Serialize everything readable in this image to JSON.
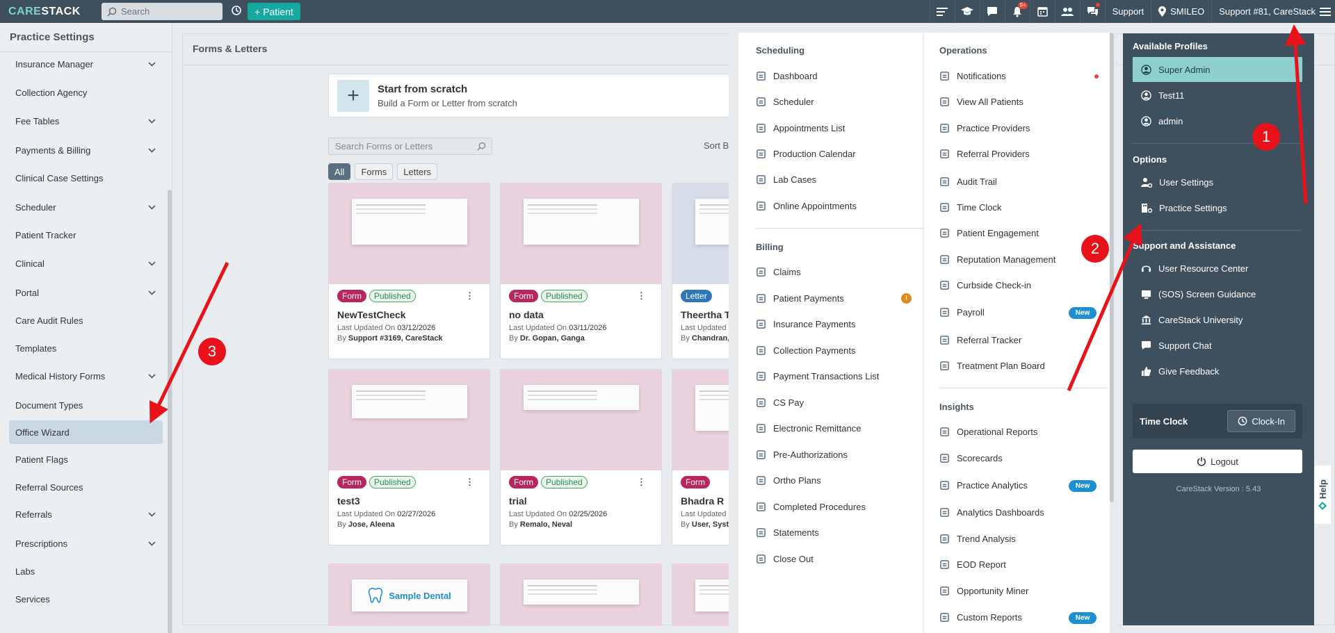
{
  "topbar": {
    "logo_care": "CARE",
    "logo_stack": "STACK",
    "search_placeholder": "Search",
    "patient_label": "Patient",
    "notifications_badge": "9+",
    "support_label": "Support",
    "location_label": "SMILEO",
    "user_label": "Support #81, CareStack"
  },
  "sidebar": {
    "title": "Practice Settings",
    "items": [
      {
        "label": "Insurance Manager",
        "expandable": true
      },
      {
        "label": "Collection Agency",
        "expandable": false
      },
      {
        "label": "Fee Tables",
        "expandable": true
      },
      {
        "label": "Payments & Billing",
        "expandable": true
      },
      {
        "label": "Clinical Case Settings",
        "expandable": false
      },
      {
        "label": "Scheduler",
        "expandable": true
      },
      {
        "label": "Patient Tracker",
        "expandable": false
      },
      {
        "label": "Clinical",
        "expandable": true
      },
      {
        "label": "Portal",
        "expandable": true
      },
      {
        "label": "Care Audit Rules",
        "expandable": false
      },
      {
        "label": "Templates",
        "expandable": false
      },
      {
        "label": "Medical History Forms",
        "expandable": true
      },
      {
        "label": "Document Types",
        "expandable": false
      },
      {
        "label": "Office Wizard",
        "expandable": false,
        "active": true
      },
      {
        "label": "Patient Flags",
        "expandable": false
      },
      {
        "label": "Referral Sources",
        "expandable": false
      },
      {
        "label": "Referrals",
        "expandable": true
      },
      {
        "label": "Prescriptions",
        "expandable": true
      },
      {
        "label": "Labs",
        "expandable": false
      },
      {
        "label": "Services",
        "expandable": false
      }
    ]
  },
  "main": {
    "title": "Forms & Letters",
    "scratch_title": "Start from scratch",
    "scratch_subtitle": "Build a Form or Letter from scratch",
    "search_placeholder": "Search Forms or Letters",
    "sort_label": "Sort By",
    "filters": [
      "All",
      "Forms",
      "Letters"
    ],
    "cards": [
      {
        "type": "Form",
        "status": "Published",
        "name": "NewTestCheck",
        "updated_label": "Last Updated On",
        "updated": "03/12/2026",
        "by_label": "By",
        "by": "Support #3169, CareStack"
      },
      {
        "type": "Form",
        "status": "Published",
        "name": "no data",
        "updated_label": "Last Updated On",
        "updated": "03/11/2026",
        "by_label": "By",
        "by": "Dr. Gopan, Ganga"
      },
      {
        "type": "Letter",
        "status": "",
        "name": "Theertha T",
        "updated_label": "Last Updated O",
        "updated": "",
        "by_label": "By",
        "by": "Chandran, A"
      },
      {
        "type": "Form",
        "status": "Published",
        "name": "test3",
        "updated_label": "Last Updated On",
        "updated": "02/27/2026",
        "by_label": "By",
        "by": "Jose, Aleena"
      },
      {
        "type": "Form",
        "status": "Published",
        "name": "trial",
        "updated_label": "Last Updated On",
        "updated": "02/25/2026",
        "by_label": "By",
        "by": "Remalo, Neval"
      },
      {
        "type": "Form",
        "status": "",
        "name": "Bhadra R",
        "updated_label": "Last Updated O",
        "updated": "",
        "by_label": "By",
        "by": "User, Syste"
      }
    ],
    "sample_dental": "Sample Dental"
  },
  "mega": {
    "scheduling_head": "Scheduling",
    "scheduling": [
      "Dashboard",
      "Scheduler",
      "Appointments List",
      "Production Calendar",
      "Lab Cases",
      "Online Appointments"
    ],
    "billing_head": "Billing",
    "billing": [
      "Claims",
      "Patient Payments",
      "Insurance Payments",
      "Collection Payments",
      "Payment Transactions List",
      "CS Pay",
      "Electronic Remittance",
      "Pre-Authorizations",
      "Ortho Plans",
      "Completed Procedures",
      "Statements",
      "Close Out"
    ],
    "operations_head": "Operations",
    "operations": [
      "Notifications",
      "View All Patients",
      "Practice Providers",
      "Referral Providers",
      "Audit Trail",
      "Time Clock",
      "Patient Engagement",
      "Reputation Management",
      "Curbside Check-in",
      "Payroll",
      "Referral Tracker",
      "Treatment Plan Board"
    ],
    "insights_head": "Insights",
    "insights": [
      "Operational Reports",
      "Scorecards",
      "Practice Analytics",
      "Analytics Dashboards",
      "Trend Analysis",
      "EOD Report",
      "Opportunity Miner",
      "Custom Reports"
    ],
    "new_label": "New",
    "warn_symbol": "!"
  },
  "profile": {
    "available_head": "Available Profiles",
    "profiles": [
      "Super Admin",
      "Test11",
      "admin"
    ],
    "options_head": "Options",
    "options": [
      "User Settings",
      "Practice Settings"
    ],
    "support_head": "Support and Assistance",
    "support": [
      "User Resource Center",
      "(SOS) Screen Guidance",
      "CareStack University",
      "Support Chat",
      "Give Feedback"
    ],
    "timeclock_label": "Time Clock",
    "clockin_label": "Clock-In",
    "logout_label": "Logout",
    "version": "CareStack Version : 5.43",
    "help_label": "Help"
  },
  "annotations": {
    "one": "1",
    "two": "2",
    "three": "3",
    "color": "#e8131a"
  }
}
